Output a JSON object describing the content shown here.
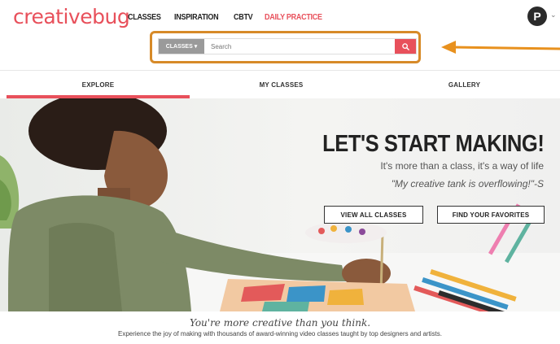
{
  "brand": {
    "logo": "creativebug",
    "accent": "#e8505b"
  },
  "topnav": {
    "classes": "CLASSES",
    "inspiration": "INSPIRATION",
    "cbtv": "CBTV",
    "daily": "DAILY PRACTICE"
  },
  "user": {
    "avatar_letter": "P"
  },
  "search": {
    "category": "CLASSES",
    "placeholder": "Search"
  },
  "annotation": {
    "highlight_color": "#d78a28"
  },
  "tabs": {
    "explore": "EXPLORE",
    "my_classes": "MY CLASSES",
    "gallery": "GALLERY"
  },
  "hero": {
    "title": "LET'S START MAKING!",
    "subtitle": "It's more than a class, it's a way of life",
    "quote": "\"My creative tank is overflowing!\"-S",
    "btn_view_all": "VIEW ALL CLASSES",
    "btn_favorites": "FIND YOUR FAVORITES"
  },
  "footer": {
    "tagline": "You're more creative than you think.",
    "description": "Experience the joy of making with thousands of award-winning video classes taught by top designers and artists."
  }
}
